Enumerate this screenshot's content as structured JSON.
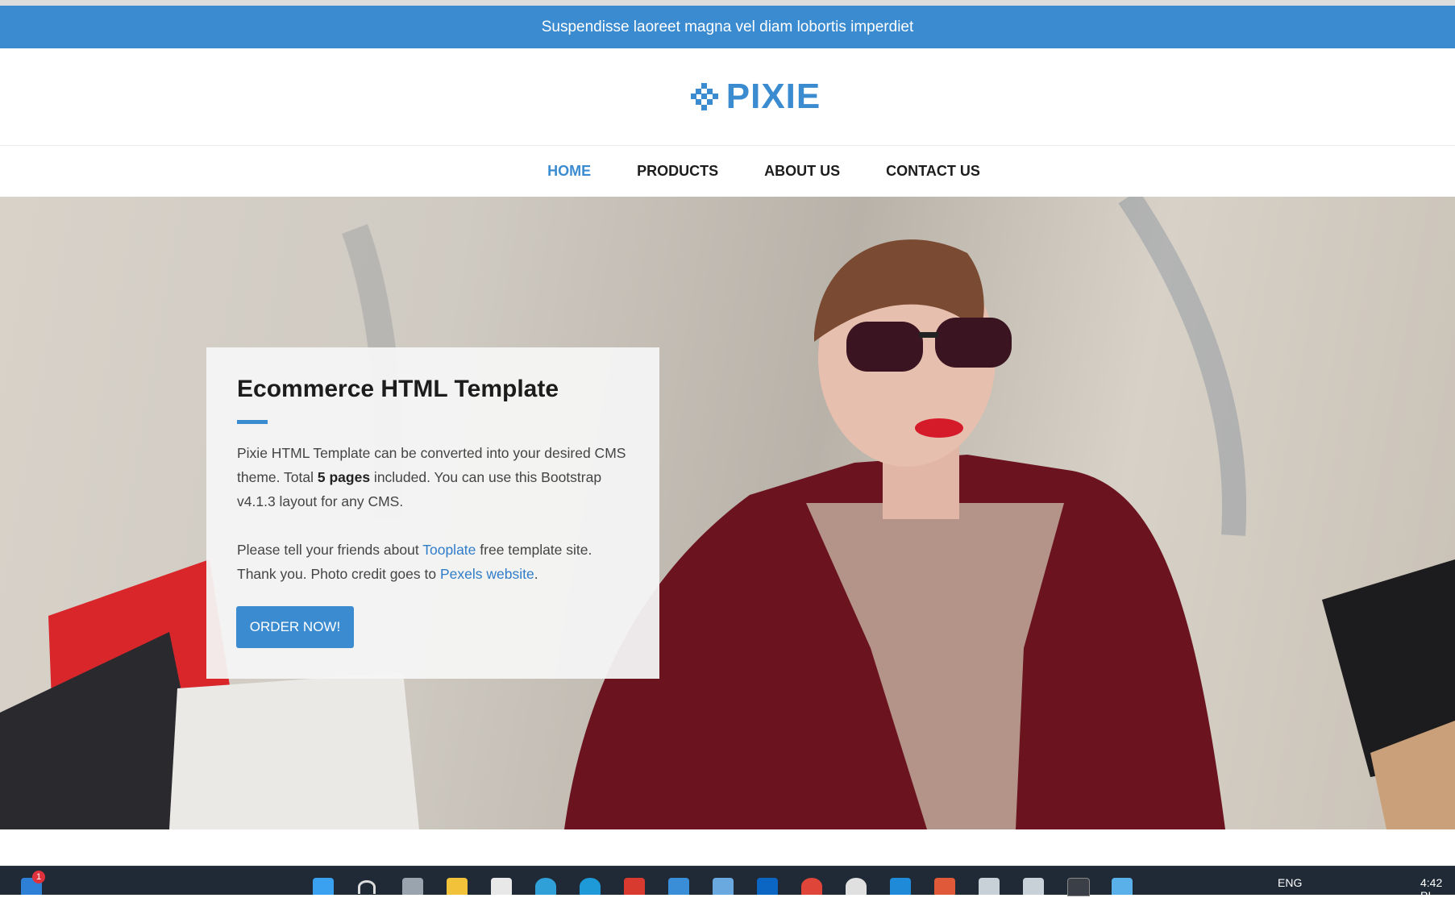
{
  "announcement": {
    "text": "Suspendisse laoreet magna vel diam lobortis imperdiet"
  },
  "brand": {
    "name": "PIXIE",
    "accent_color": "#3b8bd0"
  },
  "nav": {
    "items": [
      {
        "label": "HOME",
        "active": true
      },
      {
        "label": "PRODUCTS",
        "active": false
      },
      {
        "label": "ABOUT US",
        "active": false
      },
      {
        "label": "CONTACT US",
        "active": false
      }
    ]
  },
  "hero": {
    "title": "Ecommerce HTML Template",
    "p1_part1": "Pixie HTML Template can be converted into your desired CMS theme. Total ",
    "p1_bold": "5 pages",
    "p1_part2": " included. You can use this Bootstrap v4.1.3 layout for any CMS.",
    "p2_part1": "Please tell your friends about ",
    "p2_link1": "Tooplate",
    "p2_part2": " free template site. Thank you. Photo credit goes to ",
    "p2_link2": "Pexels website",
    "p2_part3": ".",
    "button_label": "ORDER NOW!",
    "photo": "woman-in-sunglasses-with-shopping-bags"
  },
  "taskbar": {
    "notification_count": "1",
    "language": "ENG",
    "time": "4:42 PI",
    "icons": [
      "widgets-icon",
      "start-icon",
      "search-icon",
      "task-view-icon",
      "file-explorer-icon",
      "store-icon",
      "edge-dev-icon",
      "edge-icon",
      "gmail-icon",
      "myhq-icon",
      "app-icon",
      "linkedin-icon",
      "chrome-icon",
      "slack-icon",
      "vscode-icon",
      "git-icon",
      "box-icon",
      "box2-icon",
      "terminal-icon",
      "notepad-icon"
    ]
  }
}
